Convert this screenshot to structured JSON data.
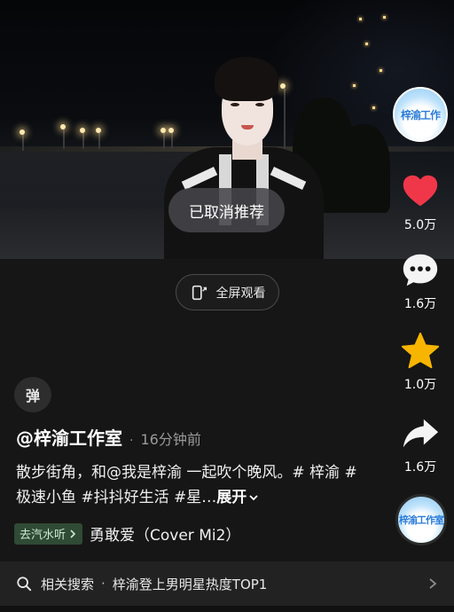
{
  "toast": "已取消推荐",
  "fullscreen_label": "全屏观看",
  "danmaku_label": "弹",
  "author": "@梓渝工作室",
  "separator_dot": "·",
  "post_time": "16分钟前",
  "caption_text": "散步街角，和@我是梓渝 一起吹个晚风。# 梓渝 #极速小鱼 #抖抖好生活 #星…",
  "caption_expand": "展开",
  "music_tag": "去汽水听",
  "song": "勇敢爱（Cover Mi2）",
  "related": {
    "label": "相关搜索",
    "sep": "·",
    "query": "梓渝登上男明星热度TOP1"
  },
  "rail": {
    "avatar_text": "梓渝工作",
    "likes": "5.0万",
    "comments": "1.6万",
    "favorites": "1.0万",
    "shares": "1.6万",
    "disc_text": "梓渝工作室"
  },
  "colors": {
    "like": "#f0374a",
    "favorite": "#f7b500",
    "background": "#161616"
  },
  "icons": [
    "heart-icon",
    "comment-icon",
    "star-icon",
    "share-icon",
    "search-icon",
    "fullscreen-icon",
    "chevron-right-icon",
    "chevron-down-icon"
  ]
}
